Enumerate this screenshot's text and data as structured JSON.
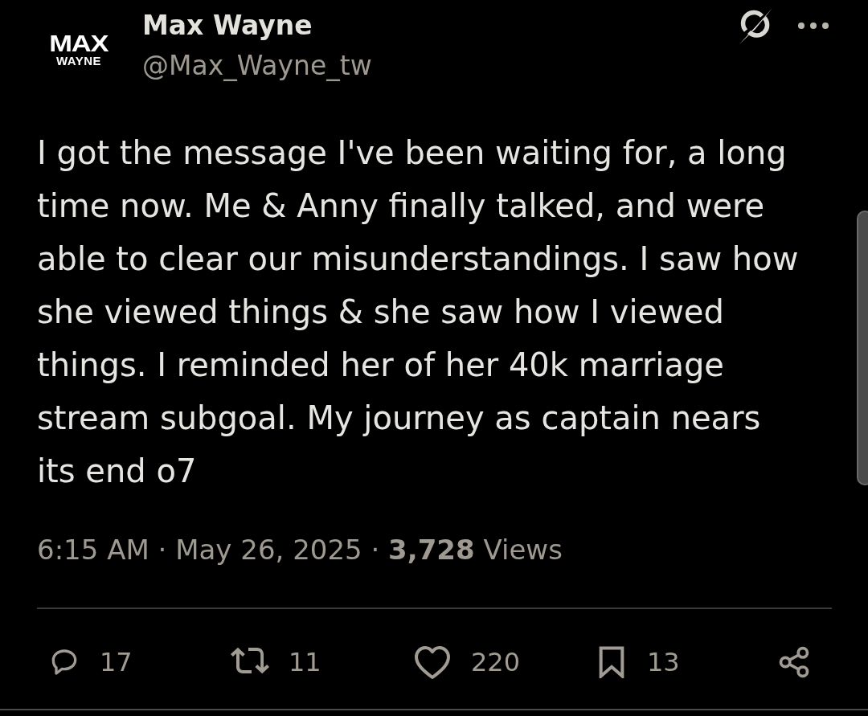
{
  "post": {
    "avatar": {
      "logo_top": "MAX",
      "logo_bottom": "WAYNE"
    },
    "author": {
      "name": "Max Wayne",
      "handle": "@Max_Wayne_tw"
    },
    "header_actions": [
      {
        "kind": "grok"
      },
      {
        "kind": "more"
      }
    ],
    "text": "I got the message I've been waiting for, a long time now. Me & Anny finally talked, and were able to clear our misunderstandings. I saw how she viewed things & she saw how I viewed things. I reminded her of her 40k marriage stream subgoal. My journey as captain nears its end o7",
    "meta": "6:15 AM · May 26, 2025 · **3,728** Views",
    "actions": [
      {
        "kind": "reply",
        "count": "17"
      },
      {
        "kind": "repost",
        "count": "11"
      },
      {
        "kind": "like",
        "count": "220"
      },
      {
        "kind": "bookmark",
        "count": "13"
      },
      {
        "kind": "share"
      }
    ]
  }
}
